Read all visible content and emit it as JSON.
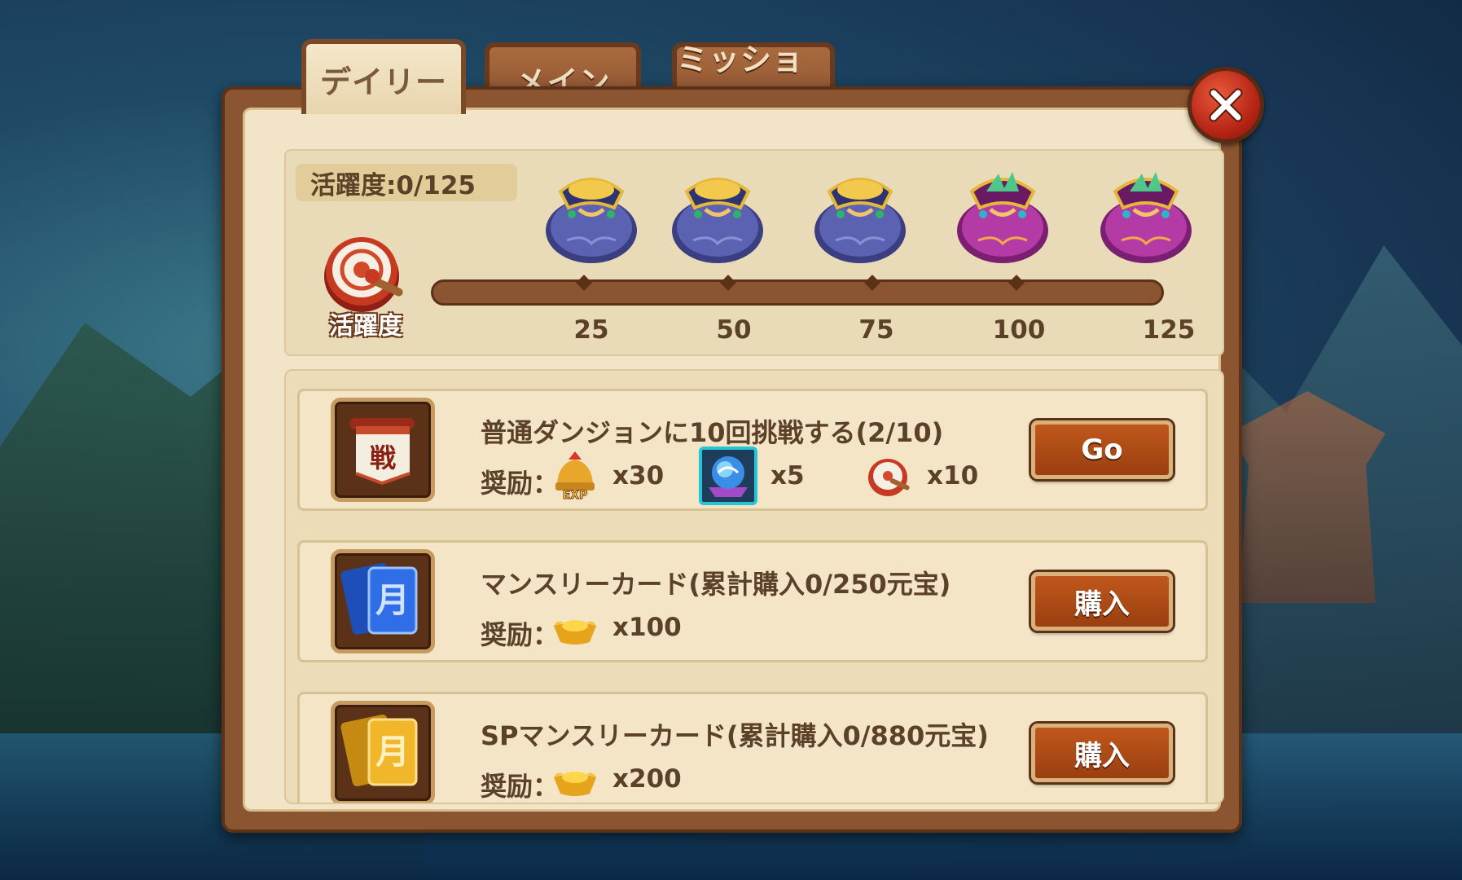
{
  "tabs": [
    {
      "label": "デイリー",
      "active": true
    },
    {
      "label": "メイン",
      "active": false
    },
    {
      "label": "ミッション",
      "active": false
    }
  ],
  "activity": {
    "label": "活躍度:0/125",
    "icon_text": "活躍度",
    "progress": 0,
    "milestones": [
      "25",
      "50",
      "75",
      "100",
      "125"
    ],
    "chests": [
      "blue-bag-icon",
      "blue-bag-icon",
      "blue-bag-icon",
      "purple-bag-icon",
      "purple-bag-icon"
    ]
  },
  "tasks": [
    {
      "title": "普通ダンジョンに10回挑戦する(2/10)",
      "reward_label": "奨励：",
      "icon": "battle-scroll-icon",
      "rewards": [
        {
          "icon": "exp-helmet-icon",
          "qty": "x30"
        },
        {
          "icon": "crystal-orb-icon",
          "qty": "x5"
        },
        {
          "icon": "drum-icon",
          "qty": "x10"
        }
      ],
      "button": "Go"
    },
    {
      "title": "マンスリーカード(累計購入0/250元宝)",
      "reward_label": "奨励：",
      "icon": "blue-card-icon",
      "rewards": [
        {
          "icon": "gold-ingot-icon",
          "qty": "x100"
        }
      ],
      "button": "購入"
    },
    {
      "title": "SPマンスリーカード(累計購入0/880元宝)",
      "reward_label": "奨励：",
      "icon": "gold-card-icon",
      "rewards": [
        {
          "icon": "gold-ingot-icon",
          "qty": "x200"
        }
      ],
      "button": "購入"
    }
  ],
  "colors": {
    "panel_brown": "#8a5530",
    "parchment": "#f2e4c6",
    "button_orange": "#b04a16",
    "close_red": "#c3301c"
  }
}
